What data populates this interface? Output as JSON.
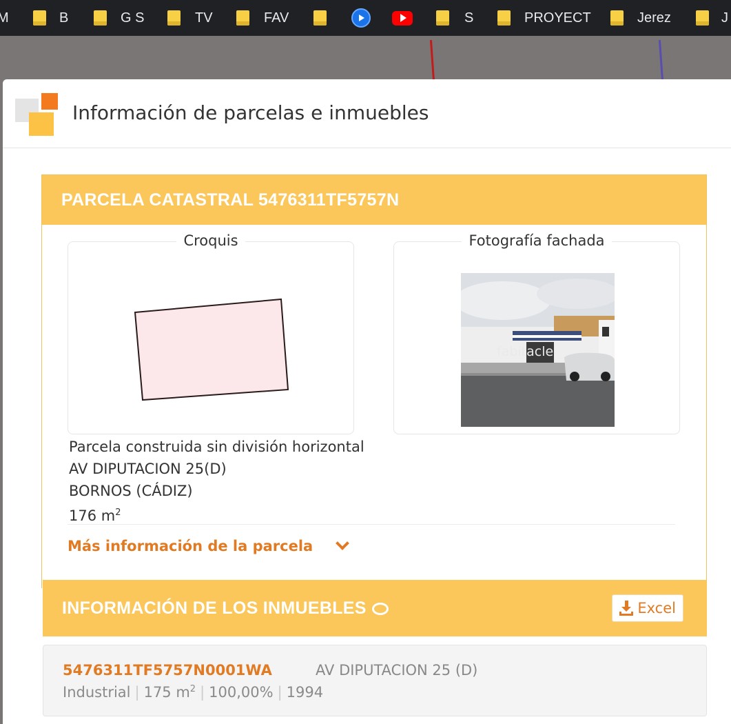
{
  "bookmarks": [
    {
      "label": "M",
      "icon": "none"
    },
    {
      "label": "B",
      "icon": "folder-icon"
    },
    {
      "label": "G S",
      "icon": "folder-icon"
    },
    {
      "label": "TV",
      "icon": "folder-icon"
    },
    {
      "label": "FAV",
      "icon": "folder-icon"
    },
    {
      "label": "",
      "icon": "folder-icon"
    },
    {
      "label": "",
      "icon": "play-icon"
    },
    {
      "label": "",
      "icon": "youtube-icon"
    },
    {
      "label": "S",
      "icon": "folder-icon"
    },
    {
      "label": "PROYECT",
      "icon": "folder-icon"
    },
    {
      "label": "Jerez",
      "icon": "folder-icon"
    },
    {
      "label": "J",
      "icon": "folder-icon"
    }
  ],
  "modal": {
    "title": "Información de parcelas e inmuebles"
  },
  "parcel": {
    "heading": "PARCELA CATASTRAL 5476311TF5757N",
    "croquis_label": "Croquis",
    "photo_label": "Fotografía fachada",
    "watermark": "fabitacle",
    "type": "Parcela construida sin división horizontal",
    "address": "AV DIPUTACION 25(D)",
    "municipality": "BORNOS (CÁDIZ)",
    "area_value": "176 m",
    "area_unit_sup": "2",
    "more_info": "Más información de la parcela"
  },
  "properties": {
    "heading": "INFORMACIÓN DE LOS INMUEBLES",
    "excel_label": "Excel",
    "items": [
      {
        "ref": "5476311TF5757N0001WA",
        "address": "AV DIPUTACION 25 (D)",
        "use": "Industrial",
        "area": "175 m",
        "area_sup": "2",
        "share": "100,00%",
        "year": "1994"
      }
    ]
  },
  "colors": {
    "accent_orange": "#e07b24",
    "header_yellow": "#fbc75b",
    "sketch_fill": "#fce8ea"
  }
}
